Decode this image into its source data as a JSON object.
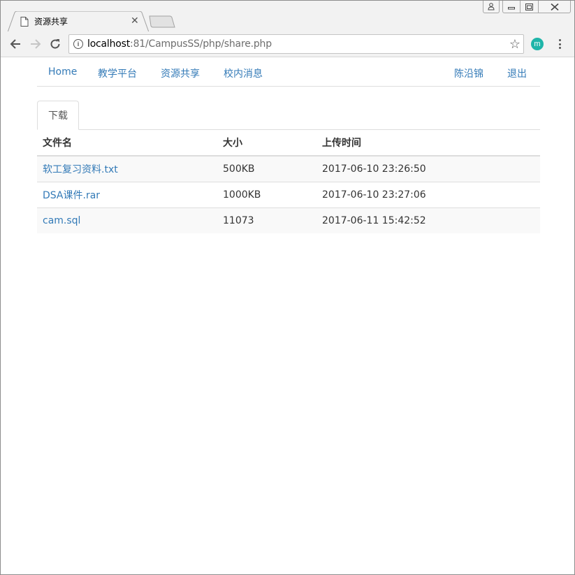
{
  "browser": {
    "tab_title": "资源共享",
    "url_host": "localhost",
    "url_rest": ":81/CampusSS/php/share.php",
    "extension_label": "m"
  },
  "navbar": {
    "links": [
      "Home",
      "教学平台",
      "资源共享",
      "校内消息"
    ],
    "user_name": "陈沿锦",
    "logout": "退出"
  },
  "tabs": {
    "active": "下载"
  },
  "table": {
    "headers": [
      "文件名",
      "大小",
      "上传时间"
    ],
    "rows": [
      {
        "name": "软工复习资料.txt",
        "size": "500KB",
        "time": "2017-06-10 23:26:50"
      },
      {
        "name": "DSA课件.rar",
        "size": "1000KB",
        "time": "2017-06-10 23:27:06"
      },
      {
        "name": "cam.sql",
        "size": "11073",
        "time": "2017-06-11 15:42:52"
      }
    ]
  },
  "colors": {
    "link": "#337ab7",
    "extension": "#1fb5a9"
  }
}
